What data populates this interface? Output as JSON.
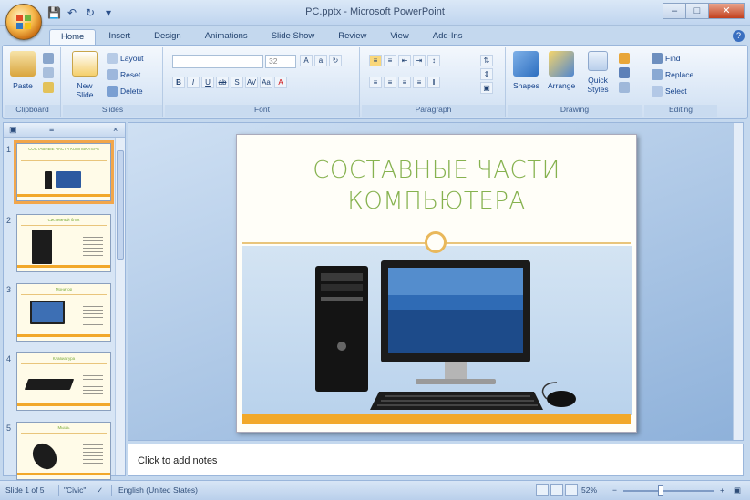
{
  "window": {
    "title": "PC.pptx - Microsoft PowerPoint"
  },
  "tabs": [
    "Home",
    "Insert",
    "Design",
    "Animations",
    "Slide Show",
    "Review",
    "View",
    "Add-Ins"
  ],
  "ribbon": {
    "clipboard": {
      "label": "Clipboard",
      "paste": "Paste"
    },
    "slides": {
      "label": "Slides",
      "new_slide": "New Slide",
      "layout": "Layout",
      "reset": "Reset",
      "delete": "Delete"
    },
    "font": {
      "label": "Font",
      "font_size": "32"
    },
    "paragraph": {
      "label": "Paragraph"
    },
    "drawing": {
      "label": "Drawing",
      "shapes": "Shapes",
      "arrange": "Arrange",
      "quick_styles": "Quick Styles"
    },
    "editing": {
      "label": "Editing",
      "find": "Find",
      "replace": "Replace",
      "select": "Select"
    }
  },
  "thumbnails": [
    {
      "num": "1",
      "title": "СОСТАВНЫЕ ЧАСТИ КОМПЬЮТЕРА",
      "selected": true
    },
    {
      "num": "2",
      "title": "Системный блок",
      "selected": false
    },
    {
      "num": "3",
      "title": "Монитор",
      "selected": false
    },
    {
      "num": "4",
      "title": "Клавиатура",
      "selected": false
    },
    {
      "num": "5",
      "title": "Мышь",
      "selected": false
    }
  ],
  "slide": {
    "title_line1": "СОСТАВНЫЕ ЧАСТИ",
    "title_line2": "КОМПЬЮТЕРА"
  },
  "notes": {
    "placeholder": "Click to add notes"
  },
  "status": {
    "slide_info": "Slide 1 of 5",
    "theme": "\"Civic\"",
    "language": "English (United States)",
    "zoom": "52%"
  },
  "colors": {
    "title_green": "#86b24f",
    "band_orange": "#f2a82a",
    "selected_outline": "#f2a64a"
  }
}
